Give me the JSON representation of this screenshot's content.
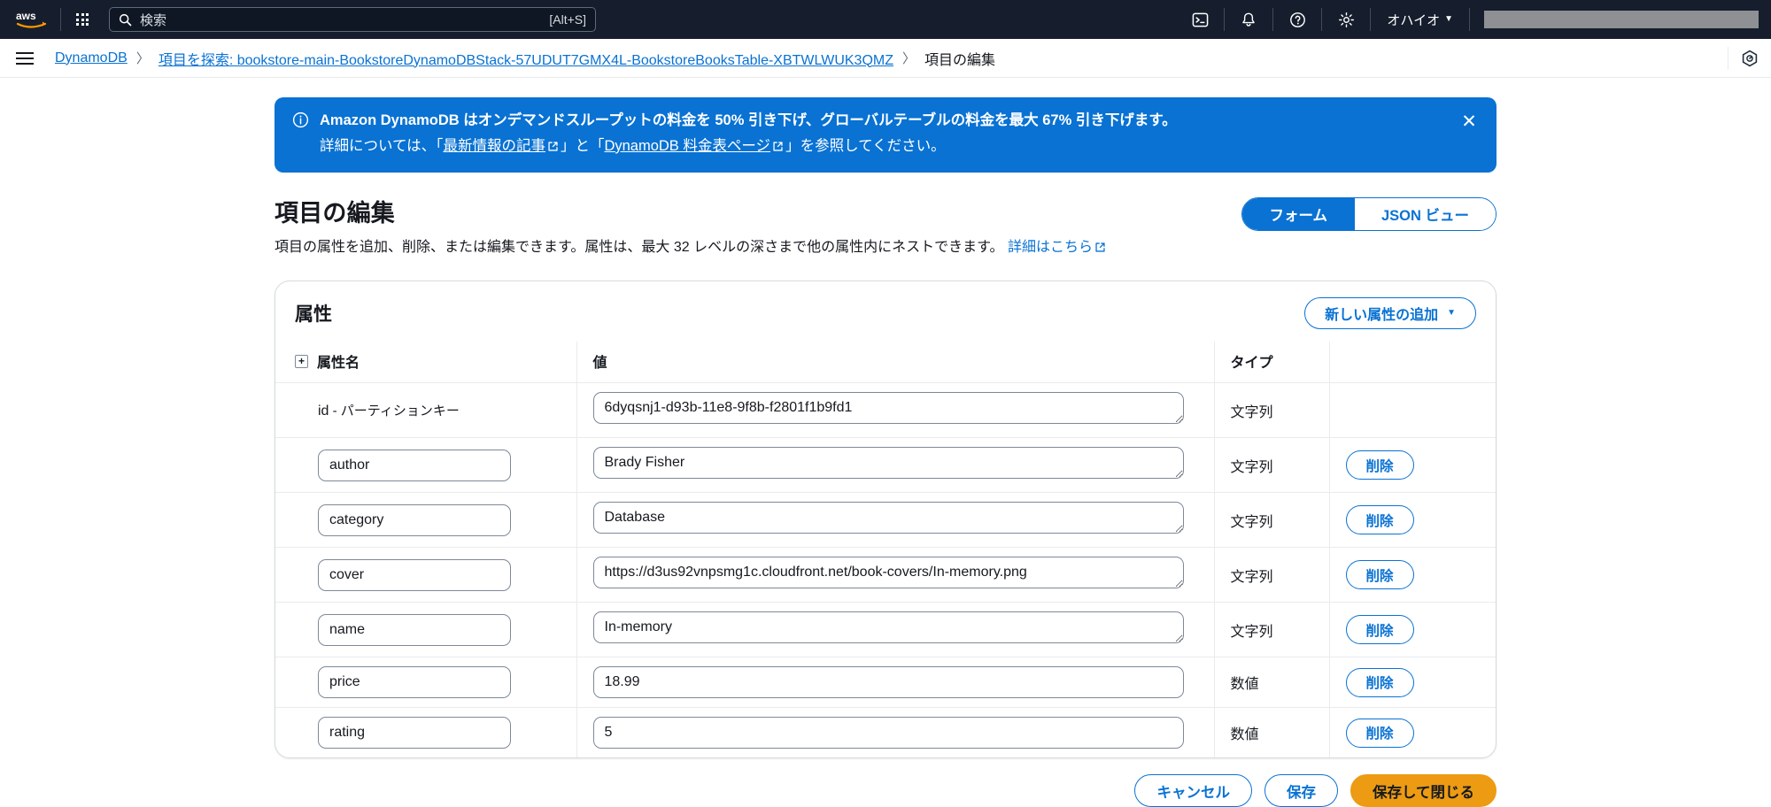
{
  "topnav": {
    "logo_alt": "aws",
    "apps_icon": "app-grid-icon",
    "search": {
      "placeholder": "検索",
      "shortcut": "[Alt+S]"
    },
    "cloudshell_icon": "cloudshell-icon",
    "notifications_icon": "bell-icon",
    "help_icon": "help-icon",
    "settings_icon": "gear-icon",
    "region": {
      "label": "オハイオ",
      "caret": "▼"
    },
    "account": ""
  },
  "breadcrumb": {
    "menu_icon": "hamburger-icon",
    "items": [
      {
        "label": "DynamoDB",
        "link": true
      },
      {
        "label": "項目を探索: bookstore-main-BookstoreDynamoDBStack-57UDUT7GMX4L-BookstoreBooksTable-XBTWLWUK3QMZ",
        "link": true
      },
      {
        "label": "項目の編集",
        "link": false
      }
    ],
    "separator": "〉",
    "right_icon": "feedback-icon"
  },
  "banner": {
    "icon": "info-icon",
    "line1": "Amazon DynamoDB はオンデマンドスループットの料金を 50% 引き下げ、グローバルテーブルの料金を最大 67% 引き下げます。",
    "line2_prefix": "詳細については、「",
    "link1": "最新情報の記事",
    "line2_mid": "」と「",
    "link2": "DynamoDB 料金表ページ",
    "line2_suffix": "」を参照してください。",
    "close_icon": "close-icon",
    "close_glyph": "✕"
  },
  "page": {
    "title": "項目の編集",
    "description": "項目の属性を追加、削除、または編集できます。属性は、最大 32 レベルの深さまで他の属性内にネストできます。",
    "learn_more": "詳細はこちら",
    "view_toggle": [
      {
        "label": "フォーム",
        "active": true
      },
      {
        "label": "JSON ビュー",
        "active": false
      }
    ]
  },
  "attributes_panel": {
    "title": "属性",
    "add_button": {
      "label": "新しい属性の追加",
      "caret": "▼"
    },
    "columns": {
      "expand_icon": "expand-all-icon",
      "expand_glyph": "+",
      "name": "属性名",
      "value": "値",
      "type": "タイプ",
      "actions": ""
    },
    "delete_label": "削除",
    "rows": [
      {
        "name": "id",
        "key_suffix": " - パーティションキー",
        "is_key": true,
        "value": "6dyqsnj1-d93b-11e8-9f8b-f2801f1b9fd1",
        "type": "文字列",
        "multiline": true,
        "deletable": false
      },
      {
        "name": "author",
        "is_key": false,
        "value": "Brady Fisher",
        "type": "文字列",
        "multiline": true,
        "deletable": true
      },
      {
        "name": "category",
        "is_key": false,
        "value": "Database",
        "type": "文字列",
        "multiline": true,
        "deletable": true
      },
      {
        "name": "cover",
        "is_key": false,
        "value": "https://d3us92vnpsmg1c.cloudfront.net/book-covers/In-memory.png",
        "type": "文字列",
        "multiline": true,
        "deletable": true
      },
      {
        "name": "name",
        "is_key": false,
        "value": "In-memory",
        "type": "文字列",
        "multiline": true,
        "deletable": true
      },
      {
        "name": "price",
        "is_key": false,
        "value": "18.99",
        "type": "数値",
        "multiline": false,
        "deletable": true
      },
      {
        "name": "rating",
        "is_key": false,
        "value": "5",
        "type": "数値",
        "multiline": false,
        "deletable": true
      }
    ]
  },
  "footer": {
    "cancel": "キャンセル",
    "save": "保存",
    "save_and_close": "保存して閉じる"
  },
  "colors": {
    "nav_background": "#161e2d",
    "link_blue": "#0972d3",
    "banner_blue": "#0972d3",
    "primary_orange": "#ec9b12",
    "border_gray": "#d5dbdb"
  }
}
